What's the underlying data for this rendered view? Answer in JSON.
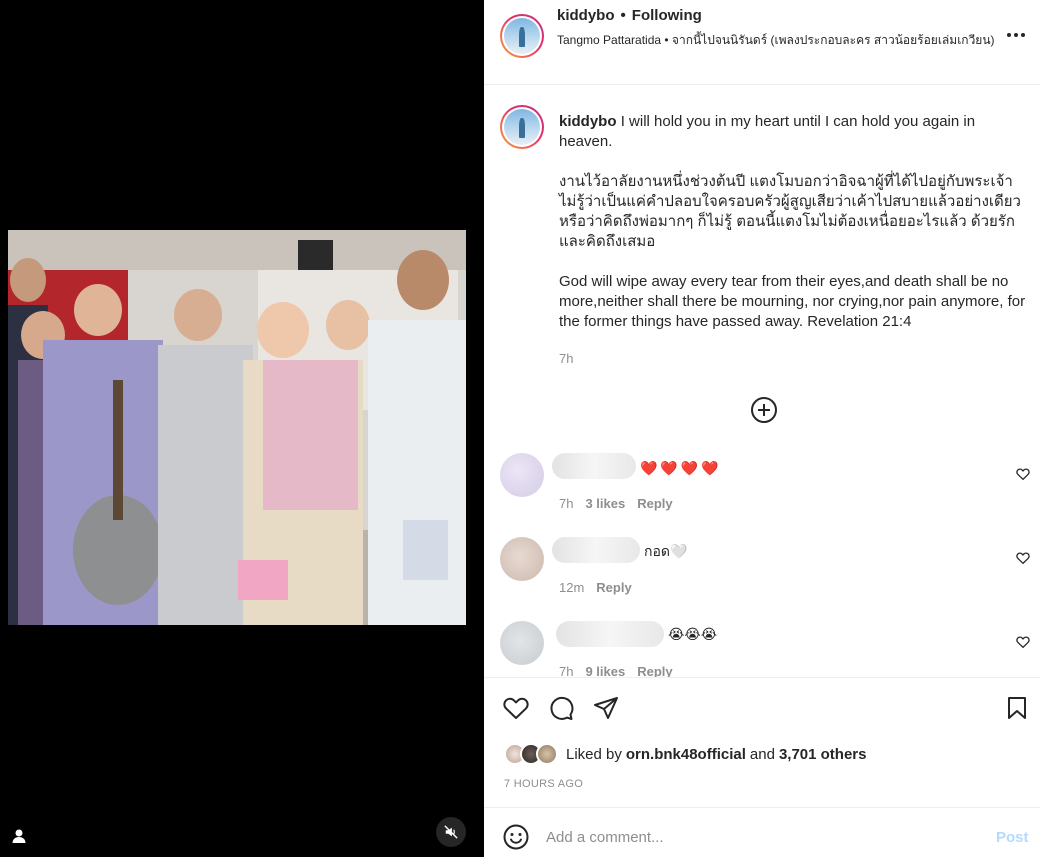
{
  "post": {
    "username": "kiddybo",
    "follow_status": "Following",
    "audio": "Tangmo Pattaratida • จากนี้ไปจนนิรันดร์ (เพลงประกอบละคร สาวน้อยร้อยเล่มเกวียน)",
    "more_icon": "more-horizontal-icon"
  },
  "caption": {
    "username": "kiddybo",
    "line1": "I will hold you in my heart until I can hold you again in heaven.",
    "line2": "งานไว้อาลัยงานหนึ่งช่วงต้นปี แตงโมบอกว่าอิจฉาผู้ที่ได้ไปอยู่กับพระเจ้า ไม่รู้ว่าเป็นแค่คำปลอบใจครอบครัวผู้สูญเสียว่าเค้าไปสบายแล้วอย่างเดียว หรือว่าคิดถึงพ่อมากๆ ก็ไม่รู้ ตอนนี้แตงโมไม่ต้องเหนื่อยอะไรแล้ว ด้วยรักและคิดถึงเสมอ",
    "line3": "God will wipe away every tear from their eyes,and death shall be no more,neither shall there be mourning, nor crying,nor pain anymore, for the former things have passed away. Revelation 21:4",
    "time": "7h"
  },
  "comments": [
    {
      "text": "❤️❤️❤️❤️",
      "time": "7h",
      "likes": "3 likes",
      "reply": "Reply"
    },
    {
      "text": "กอด🤍",
      "time": "12m",
      "likes": "",
      "reply": "Reply"
    },
    {
      "text": "😭😭😭",
      "time": "7h",
      "likes": "9 likes",
      "reply": "Reply"
    }
  ],
  "actions": {
    "liked_prefix": "Liked by",
    "liked_user": "orn.bnk48official",
    "liked_and": "and",
    "liked_others": "3,701 others",
    "posted_time": "7 HOURS AGO"
  },
  "add_comment": {
    "placeholder": "Add a comment...",
    "post_label": "Post"
  },
  "colors": {
    "link_blue": "#b3dbff",
    "heart_red": "#ed2b3c",
    "muted": "#8e8e8e"
  }
}
